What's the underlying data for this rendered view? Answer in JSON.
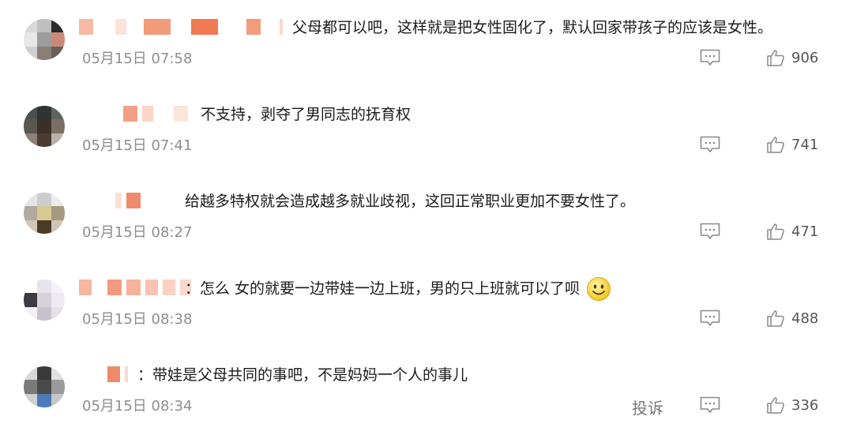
{
  "comments": [
    {
      "text": "父母都可以吧，这样就是把女性固化了，默认回家带孩子的应该是女性。",
      "date": "05月15日 07:58",
      "likes": "906",
      "reply_icon": "comment-icon",
      "like_icon": "thumbs-up-icon"
    },
    {
      "text": "不支持，剥夺了男同志的抚育权",
      "date": "05月15日 07:41",
      "likes": "741",
      "reply_icon": "comment-icon",
      "like_icon": "thumbs-up-icon"
    },
    {
      "text": "给越多特权就会造成越多就业歧视，这回正常职业更加不要女性了。",
      "date": "05月15日 08:27",
      "likes": "471",
      "reply_icon": "comment-icon",
      "like_icon": "thumbs-up-icon"
    },
    {
      "text": "：怎么 女的就要一边带娃一边上班，男的只上班就可以了呗",
      "date": "05月15日 08:38",
      "likes": "488",
      "reply_icon": "comment-icon",
      "like_icon": "thumbs-up-icon",
      "emoji": "smiley-face-icon"
    },
    {
      "text": "：带娃是父母共同的事吧，不是妈妈一个人的事儿",
      "date": "05月15日 08:34",
      "likes": "336",
      "report_label": "投诉",
      "reply_icon": "comment-icon",
      "like_icon": "thumbs-up-icon"
    }
  ],
  "colors": {
    "accent_blurred_name": "#f08a68",
    "text": "#1b1b1b",
    "meta": "#8e8e8e"
  }
}
